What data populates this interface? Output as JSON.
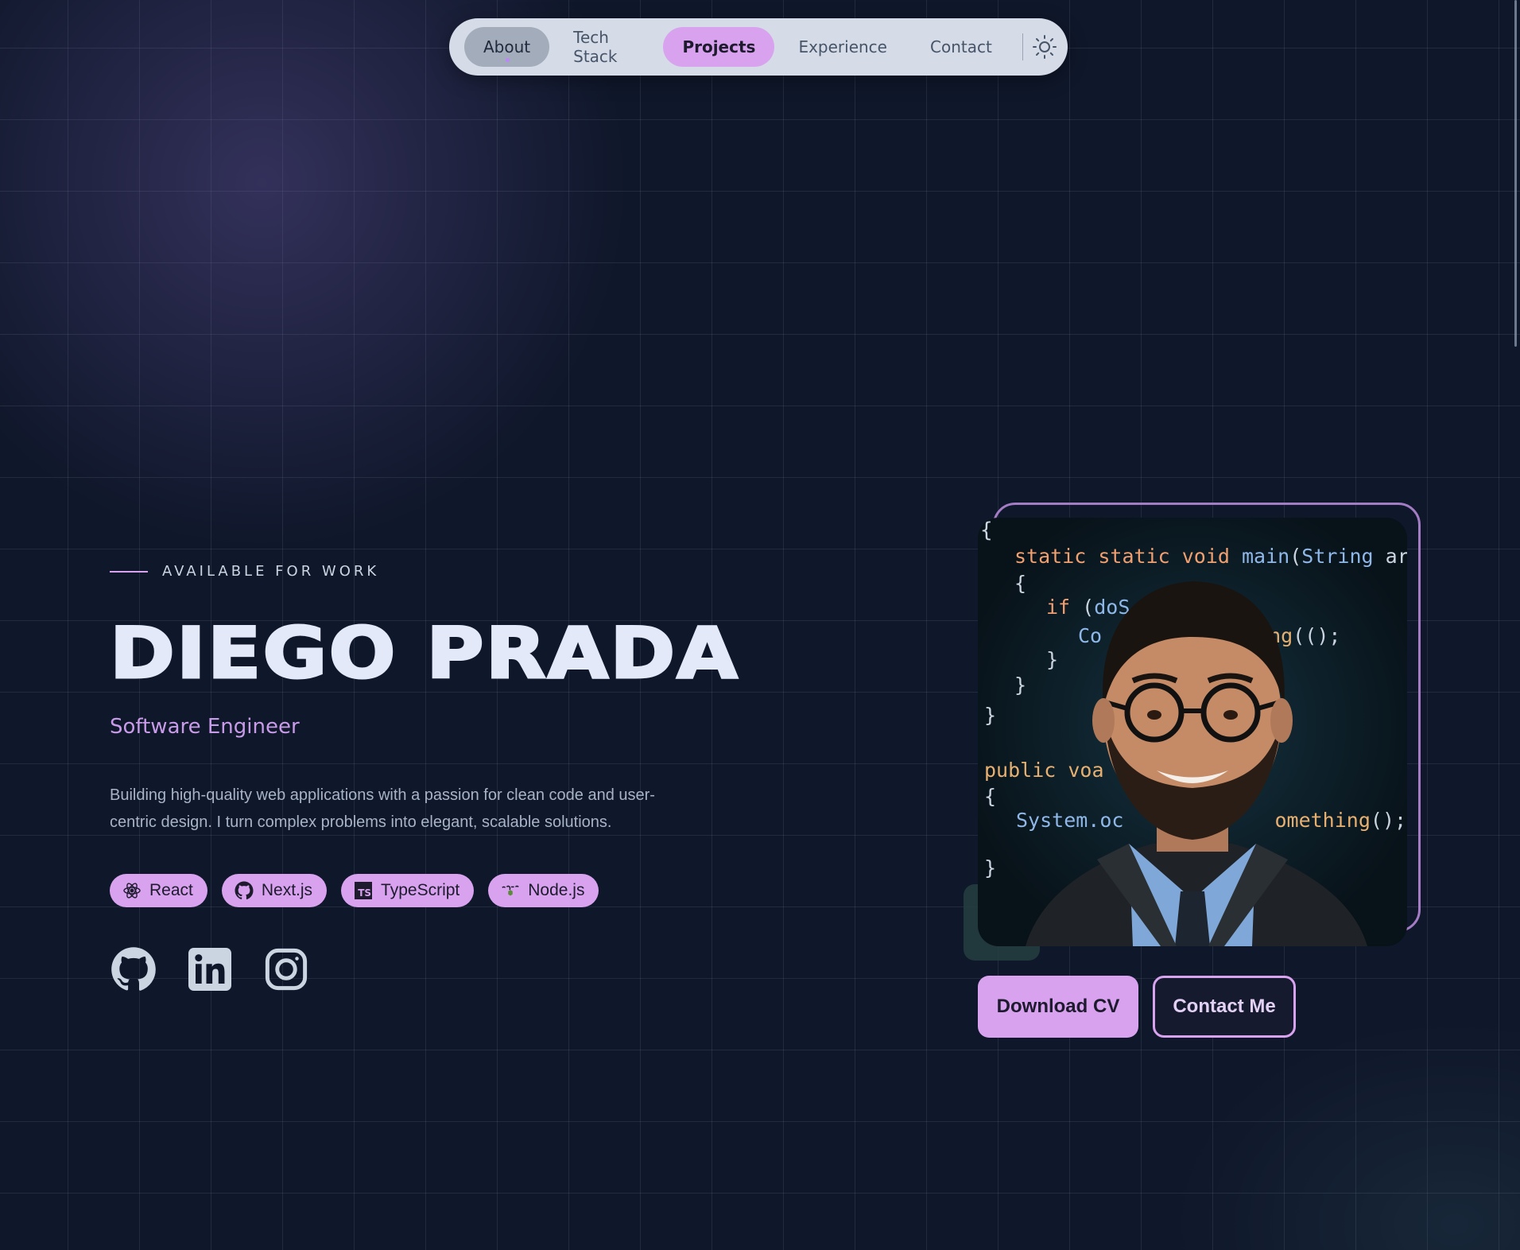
{
  "nav": {
    "items": [
      {
        "label": "About",
        "state": "hover"
      },
      {
        "label": "Tech Stack",
        "state": "default"
      },
      {
        "label": "Projects",
        "state": "active"
      },
      {
        "label": "Experience",
        "state": "default"
      },
      {
        "label": "Contact",
        "state": "default"
      }
    ],
    "theme_toggle_icon": "sun-icon"
  },
  "hero": {
    "availability": "AVAILABLE FOR WORK",
    "name": "DIEGO PRADA",
    "role": "Software Engineer",
    "description": "Building high-quality web applications with a passion for clean code and user-centric design. I turn complex problems into elegant, scalable solutions.",
    "tags": [
      {
        "label": "React",
        "icon": "react-icon"
      },
      {
        "label": "Next.js",
        "icon": "github-icon"
      },
      {
        "label": "TypeScript",
        "icon": "typescript-icon",
        "badge": "TS"
      },
      {
        "label": "Node.js",
        "icon": "nodejs-icon"
      }
    ],
    "socials": [
      {
        "name": "GitHub",
        "icon": "github-icon"
      },
      {
        "name": "LinkedIn",
        "icon": "linkedin-icon"
      },
      {
        "name": "Instagram",
        "icon": "instagram-icon"
      }
    ]
  },
  "photo": {
    "code_lines": {
      "l1_kw": "static static void ",
      "l1_fn": "main",
      "l1_rest": "(",
      "l1_ty": "String",
      "l1_tail": " args",
      "l2": "{",
      "l3_kw": "if",
      "l3_a": " (",
      "l3_b": "doS",
      "l3_c": "       ) {",
      "l4_a": "Co",
      "l4_b": "ng",
      "l4_c": "(();",
      "l5": "}",
      "l6": "}",
      "l7": "}",
      "l8_kw": "public voa",
      "l9": "{",
      "l10_a": "System.oc",
      "l10_b": "omething",
      "l10_c": "();",
      "l11": "}",
      "outer_open": "{"
    }
  },
  "actions": {
    "download": "Download CV",
    "contact": "Contact Me"
  },
  "colors": {
    "background": "#0f172a",
    "accent": "#d8a2ef",
    "nav_bg": "#d5dbe7"
  }
}
